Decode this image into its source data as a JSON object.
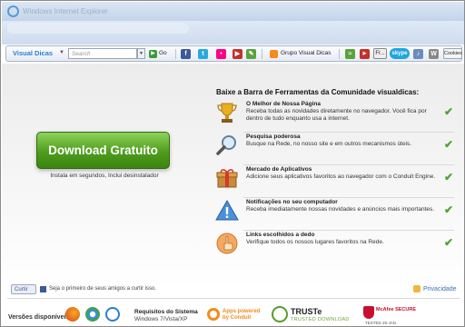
{
  "window": {
    "title": "Windows Internet Explorer"
  },
  "toolbar": {
    "brand": "Visual Dicas",
    "search_placeholder": "Search",
    "go_label": "Go",
    "group_label": "Grupo Visual Dicas",
    "fr_label": "Fr...",
    "skype_label": "skype",
    "cookies_label": "Cookies"
  },
  "main": {
    "download_button": "Download Gratuito",
    "download_sub": "Instala em segundos, Inclui desinstalador",
    "features_heading": "Baixe a Barra de Ferramentas da Comunidade visualdicas:",
    "features": [
      {
        "icon": "trophy-icon",
        "title": "O Melhor de Nossa Página",
        "desc": "Receba todas as novidades diretamente no navegador. Você fica por dentro de tudo enquanto usa a internet."
      },
      {
        "icon": "magnifier-icon",
        "title": "Pesquisa poderosa",
        "desc": "Busque na Rede, no nosso site e em outros mecanismos úteis."
      },
      {
        "icon": "gift-box-icon",
        "title": "Mercado de Aplicativos",
        "desc": "Adicione seus aplicativos favoritos ao navegador com o Conduit Engine."
      },
      {
        "icon": "warning-icon",
        "title": "Notificações no seu computador",
        "desc": "Receba imediatamente nossas novidades e anúncios mais importantes."
      },
      {
        "icon": "pointing-hand-icon",
        "title": "Links escolhidos a dedo",
        "desc": "Verifique todos os nossos lugares favoritos na Rede."
      }
    ]
  },
  "social": {
    "like_label": "Curtir",
    "like_text": "Seja o primeiro de seus amigos a curtir isso.",
    "privacy_label": "Privacidade"
  },
  "footer": {
    "versions_label": "Versões disponíveis:",
    "requirements_title": "Requisitos do Sistema",
    "requirements_text": "Windows 7/Vista/XP",
    "apps_powered": "Apps powered by Conduit",
    "truste_title": "TRUSTe",
    "truste_sub": "TRUSTED DOWNLOAD",
    "mcafee_title": "McAfee SECURE",
    "mcafee_sub": "TESTED 25-JAN"
  },
  "colors": {
    "accent": "#4e9d1d",
    "link": "#3a70b8",
    "brand": "#2a7fd0"
  }
}
